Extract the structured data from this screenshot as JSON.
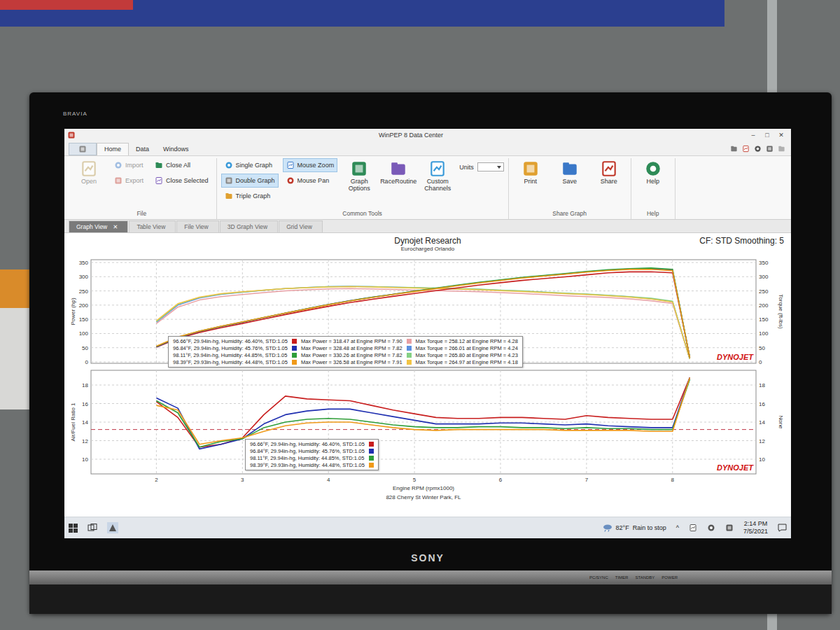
{
  "tv": {
    "brand_top": "BRAVIA",
    "brand_bottom": "SONY",
    "indicators": [
      "PC/SYNC",
      "TIMER",
      "STANDBY",
      "POWER"
    ]
  },
  "window": {
    "title": "WinPEP 8 Data Center",
    "controls": [
      "–",
      "□",
      "✕"
    ]
  },
  "ribbon": {
    "tabs": [
      {
        "label": "Home",
        "selected": true
      },
      {
        "label": "Data",
        "selected": false
      },
      {
        "label": "Windows",
        "selected": false
      }
    ],
    "groups": [
      {
        "label": "File",
        "columns": [
          [
            {
              "label": "Open",
              "kind": "large",
              "disabled": true
            }
          ],
          [
            {
              "label": "Import",
              "kind": "small",
              "disabled": true
            },
            {
              "label": "Export",
              "kind": "small",
              "disabled": true
            }
          ],
          [
            {
              "label": "Close All",
              "kind": "small",
              "disabled": false
            },
            {
              "label": "Close Selected",
              "kind": "small",
              "disabled": false
            }
          ]
        ]
      },
      {
        "label": "Common Tools",
        "columns": [
          [
            {
              "label": "Single Graph",
              "kind": "small",
              "disabled": false,
              "selected": false
            },
            {
              "label": "Double Graph",
              "kind": "small",
              "disabled": false,
              "selected": true
            },
            {
              "label": "Triple Graph",
              "kind": "small",
              "disabled": false,
              "selected": false
            }
          ],
          [
            {
              "label": "Mouse Zoom",
              "kind": "small",
              "disabled": false,
              "selected": true
            },
            {
              "label": "Mouse Pan",
              "kind": "small",
              "disabled": false,
              "selected": false
            }
          ],
          [
            {
              "label": "Graph Options",
              "kind": "large",
              "disabled": false
            }
          ],
          [
            {
              "label": "RaceRoutine",
              "kind": "large",
              "disabled": false
            }
          ],
          [
            {
              "label": "Custom Channels",
              "kind": "large",
              "disabled": false
            }
          ],
          [
            {
              "label": "Units",
              "kind": "dropdown",
              "value": "",
              "disabled": false
            }
          ]
        ]
      },
      {
        "label": "Share Graph",
        "columns": [
          [
            {
              "label": "Print",
              "kind": "large",
              "disabled": false
            }
          ],
          [
            {
              "label": "Save",
              "kind": "large",
              "disabled": false
            }
          ],
          [
            {
              "label": "Share",
              "kind": "large",
              "disabled": false
            }
          ]
        ]
      },
      {
        "label": "Help",
        "columns": [
          [
            {
              "label": "Help",
              "kind": "large",
              "disabled": false
            }
          ]
        ]
      }
    ]
  },
  "view_tabs": [
    {
      "label": "Graph View",
      "selected": true,
      "close": "✕"
    },
    {
      "label": "Table View",
      "selected": false
    },
    {
      "label": "File View",
      "selected": false
    },
    {
      "label": "3D Graph View",
      "selected": false
    },
    {
      "label": "Grid View",
      "selected": false
    }
  ],
  "chart": {
    "title": "Dynojet Research",
    "subtitle": "Eurocharged Orlando",
    "info": "CF: STD Smoothing: 5",
    "logo": "DYNOJET",
    "footer": "828 Cherry St Winter Park, FL",
    "x_axis": {
      "label": "Engine RPM (rpmx1000)",
      "ticks": [
        {
          "label": "2",
          "value": 2
        },
        {
          "label": "3",
          "value": 3
        },
        {
          "label": "4",
          "value": 4
        },
        {
          "label": "5",
          "value": 5
        },
        {
          "label": "6",
          "value": 6
        },
        {
          "label": "7",
          "value": 7
        },
        {
          "label": "8",
          "value": 8
        }
      ]
    },
    "top": {
      "left_label": "Power (hp)",
      "right_label": "Torque (ft-lbs)",
      "left_ticks": [
        {
          "label": "0",
          "value": 0
        },
        {
          "label": "50",
          "value": 50
        },
        {
          "label": "100",
          "value": 100
        },
        {
          "label": "150",
          "value": 150
        },
        {
          "label": "200",
          "value": 200
        },
        {
          "label": "250",
          "value": 250
        },
        {
          "label": "300",
          "value": 300
        },
        {
          "label": "350",
          "value": 350
        }
      ],
      "right_ticks": [
        {
          "label": "0",
          "value": 0
        },
        {
          "label": "50",
          "value": 50
        },
        {
          "label": "100",
          "value": 100
        },
        {
          "label": "150",
          "value": 150
        },
        {
          "label": "200",
          "value": 200
        },
        {
          "label": "250",
          "value": 250
        },
        {
          "label": "300",
          "value": 300
        },
        {
          "label": "350",
          "value": 350
        }
      ]
    },
    "bottom": {
      "left_label": "Air/Fuel Ratio 1",
      "right_label": "None",
      "reference": 13.2,
      "left_ticks": [
        {
          "label": "10",
          "value": 10
        },
        {
          "label": "12",
          "value": 12
        },
        {
          "label": "14",
          "value": 14
        },
        {
          "label": "16",
          "value": 16
        },
        {
          "label": "18",
          "value": 18
        }
      ],
      "right_ticks": [
        {
          "label": "10",
          "value": 10
        },
        {
          "label": "12",
          "value": 12
        },
        {
          "label": "14",
          "value": 14
        },
        {
          "label": "16",
          "value": 16
        },
        {
          "label": "18",
          "value": 18
        }
      ]
    },
    "rpm": [
      2.0,
      2.25,
      2.5,
      2.75,
      3.0,
      3.25,
      3.5,
      3.75,
      4.0,
      4.25,
      4.5,
      4.75,
      5.0,
      5.25,
      5.5,
      5.75,
      6.0,
      6.25,
      6.5,
      6.75,
      7.0,
      7.25,
      7.5,
      7.75,
      8.0,
      8.2
    ],
    "runs": [
      {
        "conditions": "96.66°F, 29.94in-hg, Humidity: 46.40%, STD:1.05",
        "max_power": "Max Power = 318.47 at Engine RPM = 7.90",
        "max_torque": "Max Torque = 258.12 at Engine RPM = 4.28",
        "color": "#c81e1e",
        "torque_color": "#e8a0a4",
        "power": [
          51.4,
          82.7,
          103.8,
          120.4,
          135.4,
          151.0,
          166.6,
          181.4,
          195.7,
          208.8,
          220.2,
          230.6,
          240.9,
          250.9,
          260.8,
          270.4,
          278.7,
          286.8,
          293.3,
          299.5,
          306.6,
          313.4,
          317.0,
          317.3,
          313.8,
          15.6
        ],
        "torque": [
          135,
          193,
          218,
          230,
          237,
          244,
          250,
          254,
          257,
          258,
          257,
          255,
          253,
          251,
          249,
          247,
          244,
          241,
          237,
          233,
          230,
          227,
          222,
          215,
          206,
          10
        ],
        "afr": [
          16.2,
          14.5,
          11.3,
          11.6,
          12.3,
          14.8,
          16.8,
          16.5,
          16.4,
          16.3,
          15.8,
          15.3,
          14.9,
          14.5,
          14.4,
          14.4,
          14.5,
          14.5,
          14.4,
          14.3,
          14.7,
          14.5,
          14.4,
          14.3,
          14.3,
          18.8
        ]
      },
      {
        "conditions": "96.84°F, 29.94in-hg, Humidity: 45.76%, STD:1.05",
        "max_power": "Max Power = 328.48 at Engine RPM = 7.82",
        "max_torque": "Max Torque = 266.01 at Engine RPM = 4.24",
        "color": "#1f2fb0",
        "torque_color": "#5b8fe0",
        "power": [
          53.3,
          85.7,
          107.1,
          124.6,
          139.9,
          155.9,
          171.9,
          187.1,
          201.8,
          215.3,
          227.1,
          237.9,
          248.5,
          258.9,
          269.1,
          279.2,
          287.9,
          296.3,
          303.2,
          309.7,
          317.2,
          323.0,
          327.0,
          327.6,
          322.9,
          15.6
        ],
        "torque": [
          140,
          200,
          225,
          238,
          245,
          252,
          258,
          262,
          265,
          266,
          265,
          263,
          261,
          259,
          257,
          255,
          252,
          249,
          245,
          241,
          238,
          234,
          229,
          222,
          212,
          10
        ],
        "afr": [
          16.6,
          15.5,
          11.1,
          11.6,
          12.2,
          13.8,
          14.8,
          15.2,
          15.4,
          15.4,
          15.0,
          14.6,
          14.2,
          13.8,
          13.8,
          13.8,
          13.9,
          13.9,
          13.8,
          13.7,
          13.8,
          13.6,
          13.5,
          13.4,
          13.4,
          18.8
        ]
      },
      {
        "conditions": "98.11°F, 29.94in-hg, Humidity: 44.85%, STD:1.05",
        "max_power": "Max Power = 330.26 at Engine RPM = 7.82",
        "max_torque": "Max Torque = 265.80 at Engine RPM = 4.23",
        "color": "#2e9e3a",
        "torque_color": "#84d084",
        "power": [
          54.1,
          87.0,
          108.1,
          125.1,
          140.5,
          156.6,
          171.9,
          187.1,
          201.8,
          215.1,
          227.1,
          237.9,
          249.4,
          259.9,
          270.2,
          280.3,
          289.0,
          297.5,
          304.5,
          311.0,
          318.5,
          324.4,
          328.4,
          330.5,
          326.0,
          15.6
        ],
        "torque": [
          142,
          203,
          227,
          239,
          246,
          253,
          258,
          262,
          265,
          265.8,
          265,
          263,
          262,
          260,
          258,
          256,
          253,
          250,
          246,
          242,
          239,
          235,
          230,
          224,
          214,
          10
        ],
        "afr": [
          16.3,
          15.0,
          11.3,
          11.9,
          12.2,
          13.4,
          14.0,
          14.3,
          14.4,
          14.3,
          14.0,
          13.7,
          13.5,
          13.4,
          13.4,
          13.5,
          13.5,
          13.4,
          13.4,
          13.3,
          13.4,
          13.3,
          13.3,
          13.2,
          13.2,
          18.6
        ]
      },
      {
        "conditions": "98.39°F, 29.93in-hg, Humidity: 44.48%, STD:1.05",
        "max_power": "Max Power = 326.58 at Engine RPM = 7.91",
        "max_torque": "Max Torque = 264.97 at Engine RPM = 4.18",
        "color": "#f09a1a",
        "torque_color": "#f2c445",
        "power": [
          55.2,
          87.8,
          108.5,
          125.7,
          141.1,
          156.6,
          171.9,
          186.4,
          201.1,
          214.4,
          226.2,
          237.0,
          247.5,
          257.9,
          268.1,
          278.1,
          286.7,
          295.1,
          302.0,
          308.5,
          315.9,
          321.6,
          325.6,
          326.1,
          321.4,
          15.6
        ],
        "torque": [
          145,
          205,
          228,
          240,
          247,
          253,
          258,
          261,
          264,
          265,
          264,
          262,
          260,
          258,
          256,
          254,
          251,
          248,
          244,
          240,
          237,
          233,
          228,
          221,
          211,
          10
        ],
        "afr": [
          15.8,
          15.3,
          11.6,
          12.0,
          12.3,
          13.0,
          13.6,
          13.9,
          14.0,
          14.0,
          13.7,
          13.4,
          13.2,
          13.1,
          13.2,
          13.2,
          13.2,
          13.2,
          13.2,
          13.1,
          13.1,
          13.1,
          13.1,
          13.0,
          13.0,
          18.8
        ]
      }
    ]
  },
  "taskbar": {
    "temperature": "82°F",
    "weather": "Rain to stop",
    "chevron": "^",
    "time": "2:14 PM",
    "date": "7/5/2021"
  }
}
